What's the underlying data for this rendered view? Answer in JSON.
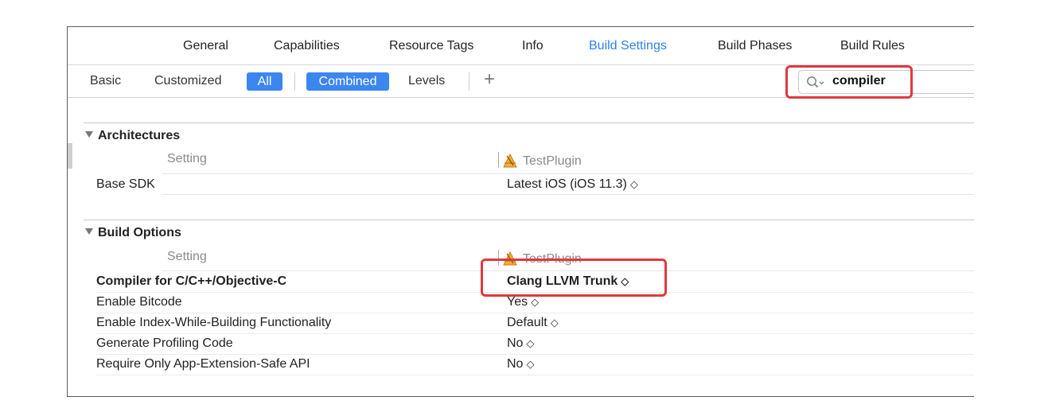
{
  "tabs": {
    "general": "General",
    "capabilities": "Capabilities",
    "resource_tags": "Resource Tags",
    "info": "Info",
    "build_settings": "Build Settings",
    "build_phases": "Build Phases",
    "build_rules": "Build Rules"
  },
  "filters": {
    "basic": "Basic",
    "customized": "Customized",
    "all": "All",
    "combined": "Combined",
    "levels": "Levels",
    "add": "+"
  },
  "search": {
    "value": "compiler"
  },
  "sections": {
    "architectures": {
      "title": "Architectures",
      "setting_header": "Setting",
      "target_header": "TestPlugin",
      "rows": [
        {
          "name": "Base SDK",
          "value": "Latest iOS (iOS 11.3)"
        }
      ]
    },
    "build_options": {
      "title": "Build Options",
      "setting_header": "Setting",
      "target_header": "TestPlugin",
      "rows": [
        {
          "name": "Compiler for C/C++/Objective-C",
          "value": "Clang LLVM Trunk"
        },
        {
          "name": "Enable Bitcode",
          "value": "Yes"
        },
        {
          "name": "Enable Index-While-Building Functionality",
          "value": "Default"
        },
        {
          "name": "Generate Profiling Code",
          "value": "No"
        },
        {
          "name": "Require Only App-Extension-Safe API",
          "value": "No"
        }
      ]
    }
  },
  "stepper_glyph": "◇",
  "colors": {
    "accent": "#3c86f0",
    "highlight": "#e0393e",
    "active_tab": "#2f80ed"
  }
}
